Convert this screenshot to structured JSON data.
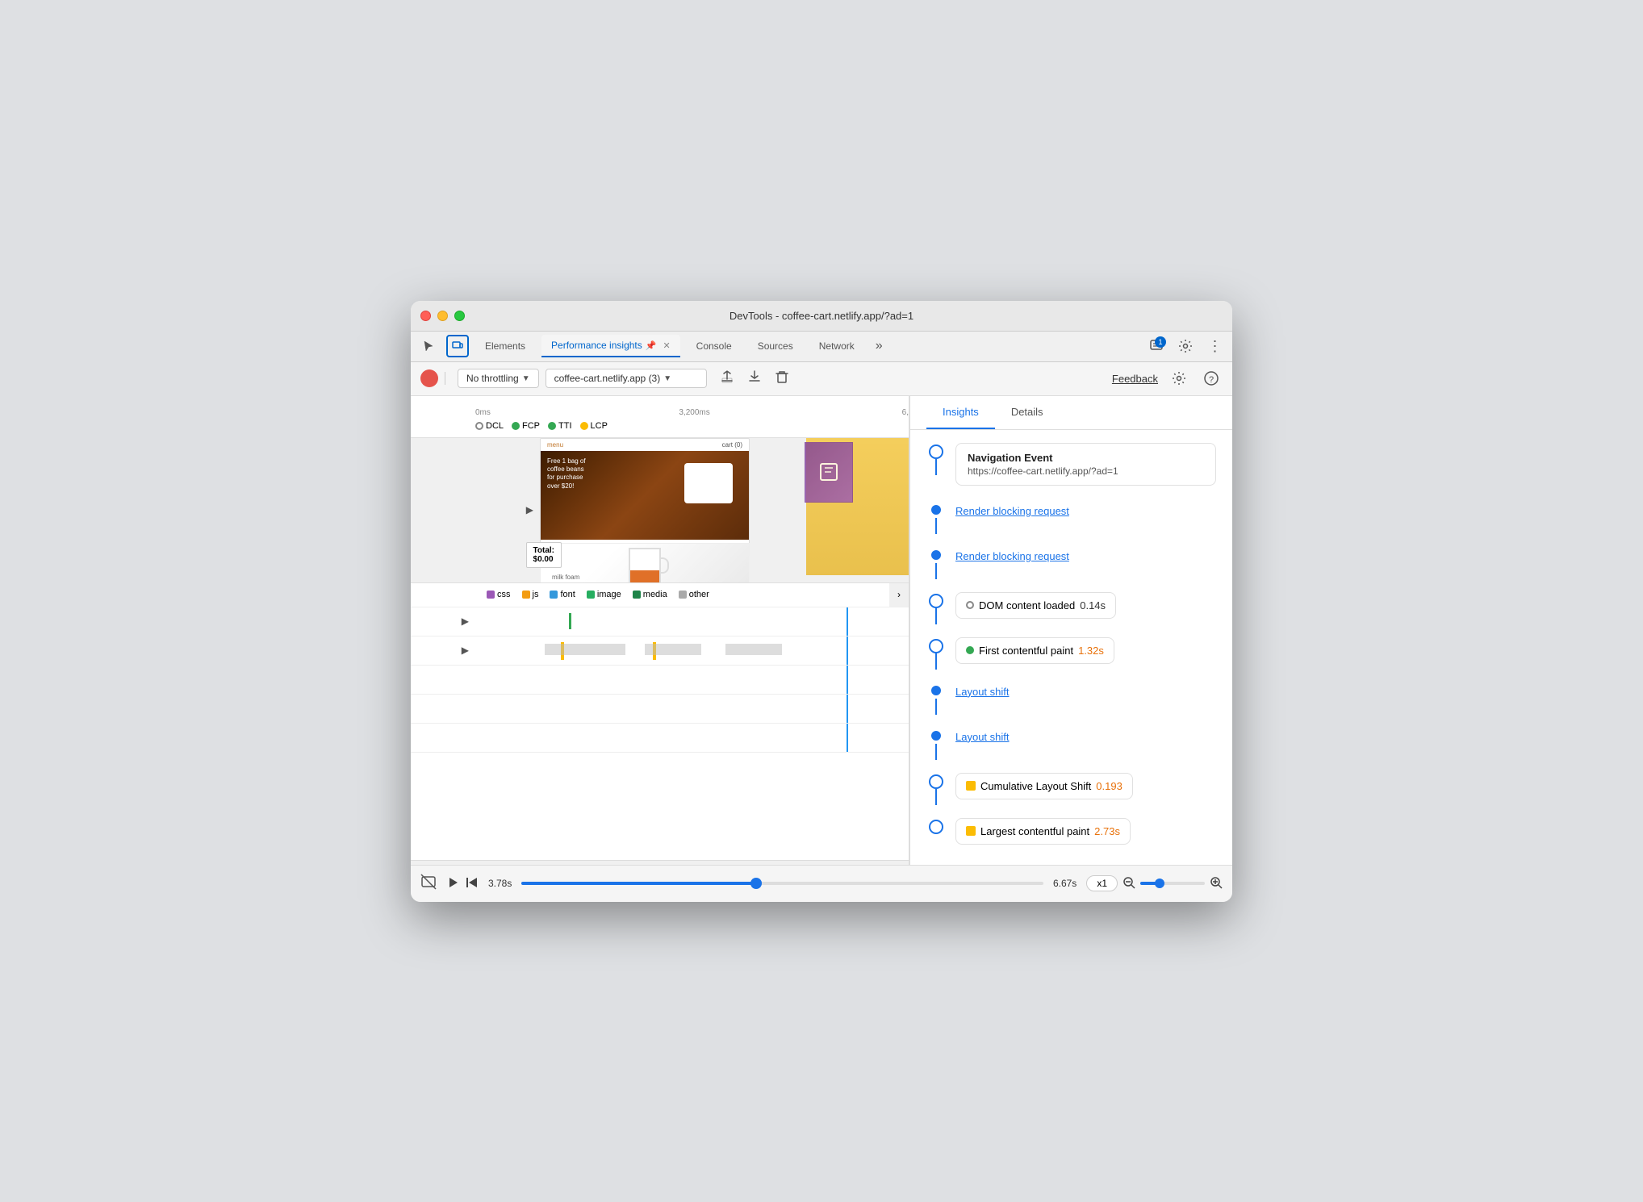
{
  "window": {
    "title": "DevTools - coffee-cart.netlify.app/?ad=1"
  },
  "tabs": {
    "items": [
      {
        "label": "Elements",
        "active": false
      },
      {
        "label": "Performance insights",
        "active": true,
        "pinned": true
      },
      {
        "label": "Console",
        "active": false
      },
      {
        "label": "Sources",
        "active": false
      },
      {
        "label": "Network",
        "active": false
      }
    ],
    "more_label": "»",
    "badge_count": "1"
  },
  "toolbar": {
    "throttling_label": "No throttling",
    "url_label": "coffee-cart.netlify.app (3)",
    "feedback_label": "Feedback"
  },
  "timeline": {
    "time_start": "0ms",
    "time_mid": "3,200ms",
    "time_end": "6,",
    "markers": {
      "dcl": "DCL",
      "fcp": "FCP",
      "tti": "TTI",
      "lcp": "LCP"
    }
  },
  "legend": {
    "items": [
      {
        "label": "css",
        "color": "#9b59b6"
      },
      {
        "label": "js",
        "color": "#f39c12"
      },
      {
        "label": "font",
        "color": "#3498db"
      },
      {
        "label": "image",
        "color": "#2ecc71"
      },
      {
        "label": "media",
        "color": "#27ae60"
      },
      {
        "label": "other",
        "color": "#aaa"
      }
    ]
  },
  "insights": {
    "tabs": [
      {
        "label": "Insights",
        "active": true
      },
      {
        "label": "Details",
        "active": false
      }
    ],
    "items": [
      {
        "type": "navigation",
        "title": "Navigation Event",
        "url": "https://coffee-cart.netlify.app/?ad=1"
      },
      {
        "type": "link",
        "label": "Render blocking request"
      },
      {
        "type": "link",
        "label": "Render blocking request"
      },
      {
        "type": "badge",
        "icon": "circle-outline",
        "label": "DOM content loaded",
        "value": "0.14s"
      },
      {
        "type": "badge",
        "icon": "green-dot",
        "label": "First contentful paint",
        "value": "1.32s"
      },
      {
        "type": "link",
        "label": "Layout shift"
      },
      {
        "type": "link",
        "label": "Layout shift"
      },
      {
        "type": "badge",
        "icon": "orange-square",
        "label": "Cumulative Layout Shift",
        "value": "0.193"
      },
      {
        "type": "badge",
        "icon": "orange-square",
        "label": "Largest contentful paint",
        "value": "2.73s"
      }
    ]
  },
  "bottom_bar": {
    "time_current": "3.78s",
    "time_end": "6.67s",
    "speed_label": "x1"
  }
}
